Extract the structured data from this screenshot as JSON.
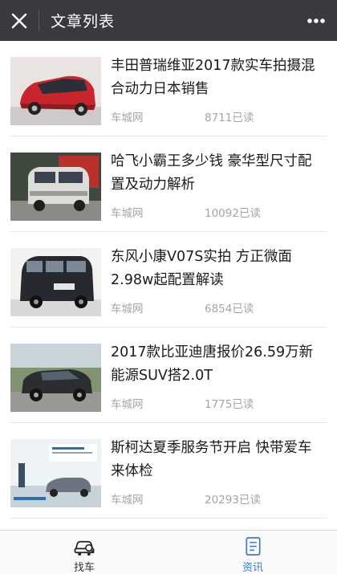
{
  "header": {
    "title": "文章列表"
  },
  "articles": [
    {
      "title": "丰田普瑞维亚2017款实车拍摄混合动力日本销售",
      "source": "车城网",
      "reads": "8711已读"
    },
    {
      "title": "哈飞小霸王多少钱 豪华型尺寸配置及动力解析",
      "source": "车城网",
      "reads": "10092已读"
    },
    {
      "title": "东风小康V07S实拍 方正微面2.98w起配置解读",
      "source": "车城网",
      "reads": "6854已读"
    },
    {
      "title": "2017款比亚迪唐报价26.59万新能源SUV搭2.0T",
      "source": "车城网",
      "reads": "1775已读"
    },
    {
      "title": "斯柯达夏季服务节开启 快带爱车来体检",
      "source": "车城网",
      "reads": "20293已读"
    }
  ],
  "tabs": [
    {
      "label": "找车",
      "icon": "car-search-icon",
      "active": false
    },
    {
      "label": "资讯",
      "icon": "news-icon",
      "active": true
    }
  ],
  "colors": {
    "topbar": "#393a3f",
    "active_tab": "#3a7bd5",
    "meta_text": "#a5a5a5"
  }
}
